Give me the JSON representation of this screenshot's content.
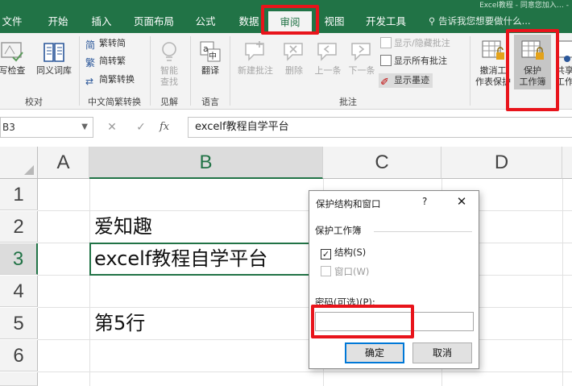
{
  "title_bar": {
    "text": "Excel教程 - 同意您加入… -"
  },
  "tabs": [
    {
      "label": "文件"
    },
    {
      "label": "开始"
    },
    {
      "label": "插入"
    },
    {
      "label": "页面布局"
    },
    {
      "label": "公式"
    },
    {
      "label": "数据"
    },
    {
      "label": "审阅"
    },
    {
      "label": "视图"
    },
    {
      "label": "开发工具"
    }
  ],
  "active_tab": "审阅",
  "tell_me": "告诉我您想要做什么...",
  "ribbon": {
    "proofing": {
      "spell_partial": "写检查",
      "thesaurus": "同义词库",
      "group": "校对"
    },
    "chinese_conversion": {
      "to_simplified": "繁转简",
      "to_traditional": "简转繁",
      "convert": "简繁转换",
      "group": "中文简繁转换"
    },
    "insights": {
      "smart_lookup_1": "智能",
      "smart_lookup_2": "查找",
      "group": "见解"
    },
    "language": {
      "translate": "翻译",
      "group": "语言"
    },
    "comments": {
      "new_comment": "新建批注",
      "delete": "删除",
      "previous": "上一条",
      "next": "下一条",
      "show_hide": "显示/隐藏批注",
      "show_all": "显示所有批注",
      "show_ink": "显示墨迹",
      "group": "批注"
    },
    "changes": {
      "unprotect_sheet_1": "撤消工",
      "unprotect_sheet_2": "作表保护",
      "protect_workbook_1": "保护",
      "protect_workbook_2": "工作簿",
      "share_1": "共享",
      "share_2": "工作"
    }
  },
  "formula_bar": {
    "name_box": "B3",
    "formula": "excelf教程自学平台"
  },
  "columns": [
    "A",
    "B",
    "C",
    "D"
  ],
  "rows": [
    "1",
    "2",
    "3",
    "4",
    "5",
    "6"
  ],
  "cells": {
    "B2": "爱知趣",
    "B3": "excelf教程自学平台",
    "B5": "第5行"
  },
  "dialog": {
    "title": "保护结构和窗口",
    "help": "?",
    "close": "✕",
    "section": "保护工作簿",
    "structure_label": "结构(S)",
    "structure_checked": true,
    "windows_label": "窗口(W)",
    "windows_checked": false,
    "password_label": "密码(可选)(P):",
    "password_value": "",
    "ok": "确定",
    "cancel": "取消"
  },
  "colors": {
    "excel_green": "#217346",
    "highlight_red": "#e8141b",
    "ribbon_bg": "#f3f3f3"
  }
}
